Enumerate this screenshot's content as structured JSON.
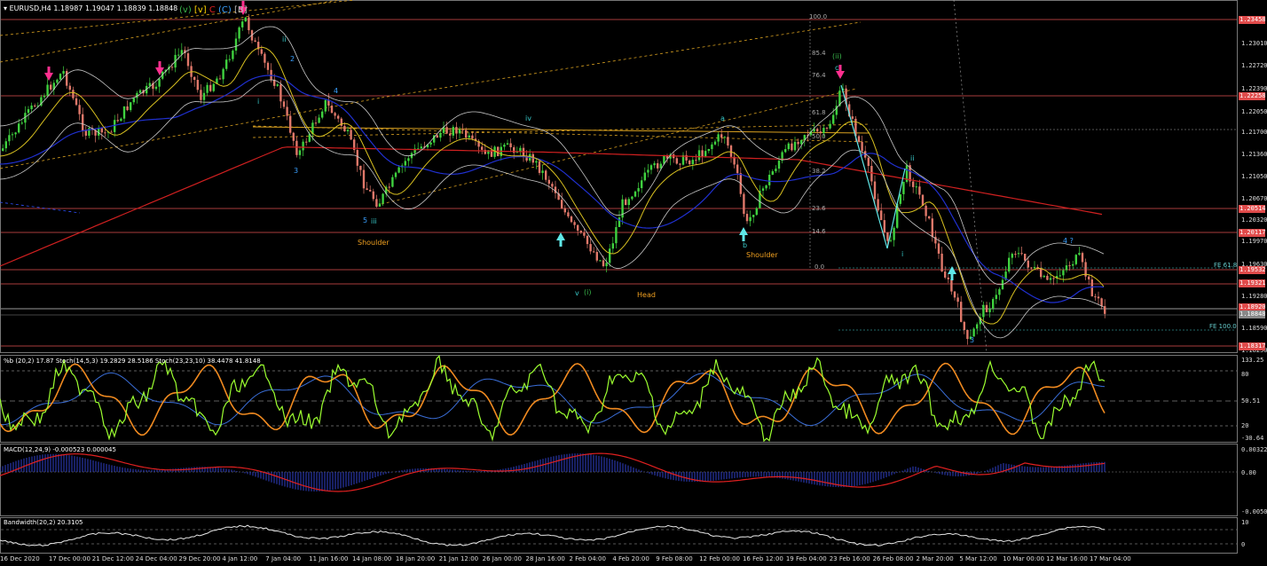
{
  "header": {
    "symbol_line": "EURUSD,H4  1.18987 1.19047 1.18839 1.18848",
    "wave_labels": [
      {
        "text": "(v)",
        "color": "#39b54a"
      },
      {
        "text": "[v]",
        "color": "#ffd400"
      },
      {
        "text": "C",
        "color": "#e02020"
      },
      {
        "text": "(C)",
        "color": "#3aa0ff"
      },
      {
        "text": "[B]",
        "color": "#bbbbbb"
      }
    ]
  },
  "price_axis": {
    "ticks": [
      "1.23010",
      "1.22720",
      "1.22390",
      "1.22050",
      "1.21700",
      "1.21360",
      "1.21050",
      "1.20670",
      "1.20320",
      "1.19970",
      "1.19630",
      "1.19280",
      "1.18590",
      "1.18250"
    ],
    "tags": [
      {
        "text": "1.23458",
        "color": "#e04b4b"
      },
      {
        "text": "1.22258",
        "color": "#e04b4b"
      },
      {
        "text": "1.20514",
        "color": "#e04b4b"
      },
      {
        "text": "1.20117",
        "color": "#e04b4b"
      },
      {
        "text": "1.19532",
        "color": "#e04b4b"
      },
      {
        "text": "1.19321",
        "color": "#e04b4b"
      },
      {
        "text": "1.18920",
        "color": "#e04b4b"
      },
      {
        "text": "1.18848",
        "color": "#888888"
      },
      {
        "text": "1.18317",
        "color": "#e04b4b"
      }
    ]
  },
  "fib_levels": [
    "100.0",
    "85.4",
    "76.4",
    "61.8",
    "50.0",
    "38.2",
    "23.6",
    "14.6",
    "0.0"
  ],
  "fe_labels": [
    "FE 61.8",
    "FE 100.0"
  ],
  "annotations": {
    "shoulder_left": "Shoulder",
    "head": "Head",
    "shoulder_right": "Shoulder",
    "wave_ii_top": "ii",
    "wave_2": "2",
    "wave_4": "4",
    "wave_3": "3",
    "wave_i": "i",
    "wave_5": "5",
    "wave_iii": "iii",
    "wave_iv": "iv",
    "wave_v": "v",
    "wave_i_paren": "(i)",
    "wave_a": "a",
    "wave_b": "b",
    "wave_c": "c",
    "wave_ii_paren": "(ii)",
    "wave_ii_low": "ii",
    "wave_i_low": "i",
    "wave_3_low": "3",
    "wave_4q": "4 ?"
  },
  "stoch_panel": {
    "label": "%b (20,2) 17.87  Stoch(14,5,3) 19.2829 28.5186  Stoch(23,23,10) 38.4478 41.8148",
    "ticks": [
      "133.25",
      "80",
      "50.51",
      "20",
      "-30.64"
    ]
  },
  "macd_panel": {
    "label": "MACD(12,24,9) -0.000523 0.000045",
    "ticks": [
      "0.003225",
      "0.00",
      "-0.005062"
    ]
  },
  "bw_panel": {
    "label": "Bandwidth(20,2) 20.3105",
    "ticks": [
      "10",
      "0"
    ]
  },
  "time_axis": [
    "16 Dec 2020",
    "17 Dec 00:00",
    "21 Dec 12:00",
    "24 Dec 04:00",
    "29 Dec 20:00",
    "4 Jan 12:00",
    "7 Jan 04:00",
    "11 Jan 16:00",
    "14 Jan 08:00",
    "18 Jan 20:00",
    "21 Jan 12:00",
    "26 Jan 00:00",
    "28 Jan 16:00",
    "2 Feb 04:00",
    "4 Feb 20:00",
    "9 Feb 08:00",
    "12 Feb 00:00",
    "16 Feb 12:00",
    "19 Feb 04:00",
    "23 Feb 16:00",
    "26 Feb 08:00",
    "2 Mar 20:00",
    "5 Mar 12:00",
    "10 Mar 00:00",
    "12 Mar 16:00",
    "17 Mar 04:00"
  ],
  "colors": {
    "bull": "#3fd13f",
    "bear": "#e0786a",
    "hline": "#e05050",
    "ma_red": "#d02020",
    "ma_blue": "#2030d0",
    "ma_yellow": "#d8c020",
    "band": "#c8c8c8"
  }
}
